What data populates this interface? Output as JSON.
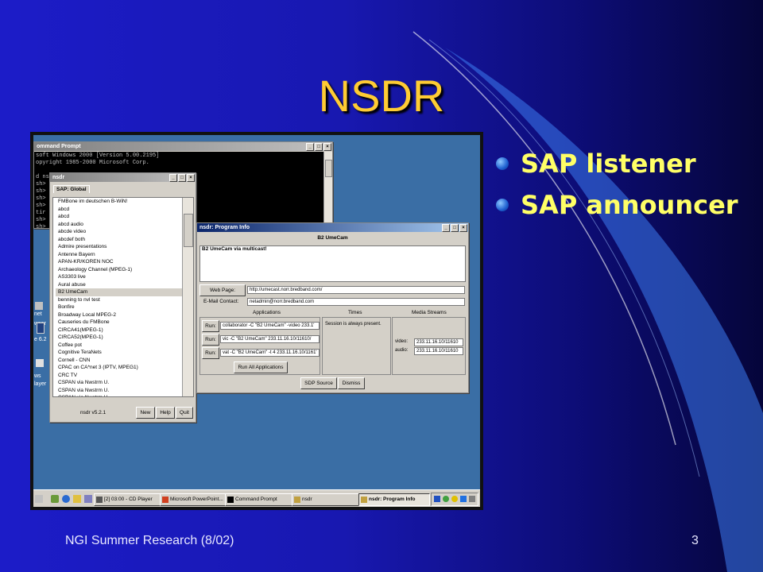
{
  "slide": {
    "title": "NSDR",
    "bullets": [
      "SAP listener",
      "SAP announcer"
    ],
    "footer_left": "NGI Summer Research (8/02)",
    "page_number": "3",
    "colors": {
      "title": "#ffcc33",
      "bullet_text": "#ffff66",
      "background": "#1818b0"
    }
  },
  "desktop": {
    "left_strip": [
      "net",
      "wser",
      "e 6.2",
      "ws",
      "layer"
    ]
  },
  "cmd_window": {
    "title": "ommand Prompt",
    "lines": [
      "soft Windows 2000 [Version 5.00.2195]",
      "opyright 1985-2000 Microsoft Corp.",
      "",
      "d nsd",
      "sh>",
      "sh>",
      "sh>",
      "sh>",
      "tir",
      "sh>",
      "sh>"
    ]
  },
  "nsdr_window": {
    "title": "nsdr",
    "tab": "SAP: Global",
    "sessions": [
      "FMBone im deutschen B-WiN!",
      "abcd",
      "abcd",
      "abcd audio",
      "abcde video",
      "abcdef both",
      "Admire presentations",
      "Antenne Bayern",
      "APAN-KR/KOREN NOC",
      "Archaeology Channel (MPEG-1)",
      "AS3303 live",
      "Aural abuse",
      "B2 UmeCam",
      "benning to nvl test",
      "Bonfire",
      "Broadway Local MPEG-2",
      "Causeries du FMBone",
      "CIRCA41(MPEG-1)",
      "CIRCA52(MPEG-1)",
      "Coffee pot",
      "Cognitive TeraNets",
      "Cornell - CNN",
      "CPAC on CA*net 3 (IPTV, MPEG1)",
      "CRC TV",
      "CSPAN via Nwstrm U.",
      "CSPAN via Nwstrm U.",
      "CSPAN via Nwstrm U."
    ],
    "selected_index": 12,
    "version": "nsdr v5.2.1",
    "buttons": [
      "New",
      "Help",
      "Quit"
    ]
  },
  "program_info": {
    "title": "nsdr: Program Info",
    "session_name": "B2 UmeCam",
    "description": "B2 UmeCam via multicast!",
    "web_page_label": "Web Page:",
    "web_page_value": "http://umecast.norr.bredband.com/",
    "email_label": "E-Mail Contact:",
    "email_value": "netadmin@norr.bredband.com",
    "sections": {
      "applications": "Applications",
      "times": "Times",
      "media": "Media Streams"
    },
    "run_label": "Run:",
    "apps": [
      "collaborator -C \"B2 UmeCam\" -video 233.1'",
      "vic -C \"B2 UmeCam\"  233.11.16.10/11610/",
      "vat -C \"B2 UmeCam\" -t 4 233.11.16.10/1161'"
    ],
    "run_all": "Run All Applications",
    "times_text": "Session is always present.",
    "media": [
      {
        "label": "video:",
        "value": "233.11.16.10/11610"
      },
      {
        "label": "audio:",
        "value": "233.11.16.10/11610"
      }
    ],
    "sdp_button": "SDP Source",
    "dismiss_button": "Dismiss"
  },
  "taskbar": {
    "items": [
      {
        "label": "[2] 03:00 - CD Player",
        "icon": "cd-player-icon",
        "active": false
      },
      {
        "label": "Microsoft PowerPoint...",
        "icon": "powerpoint-icon",
        "active": false
      },
      {
        "label": "Command Prompt",
        "icon": "cmd-icon",
        "active": false
      },
      {
        "label": "nsdr",
        "icon": "nsdr-icon",
        "active": false
      },
      {
        "label": "nsdr: Program Info",
        "icon": "nsdr-icon",
        "active": true
      }
    ]
  }
}
